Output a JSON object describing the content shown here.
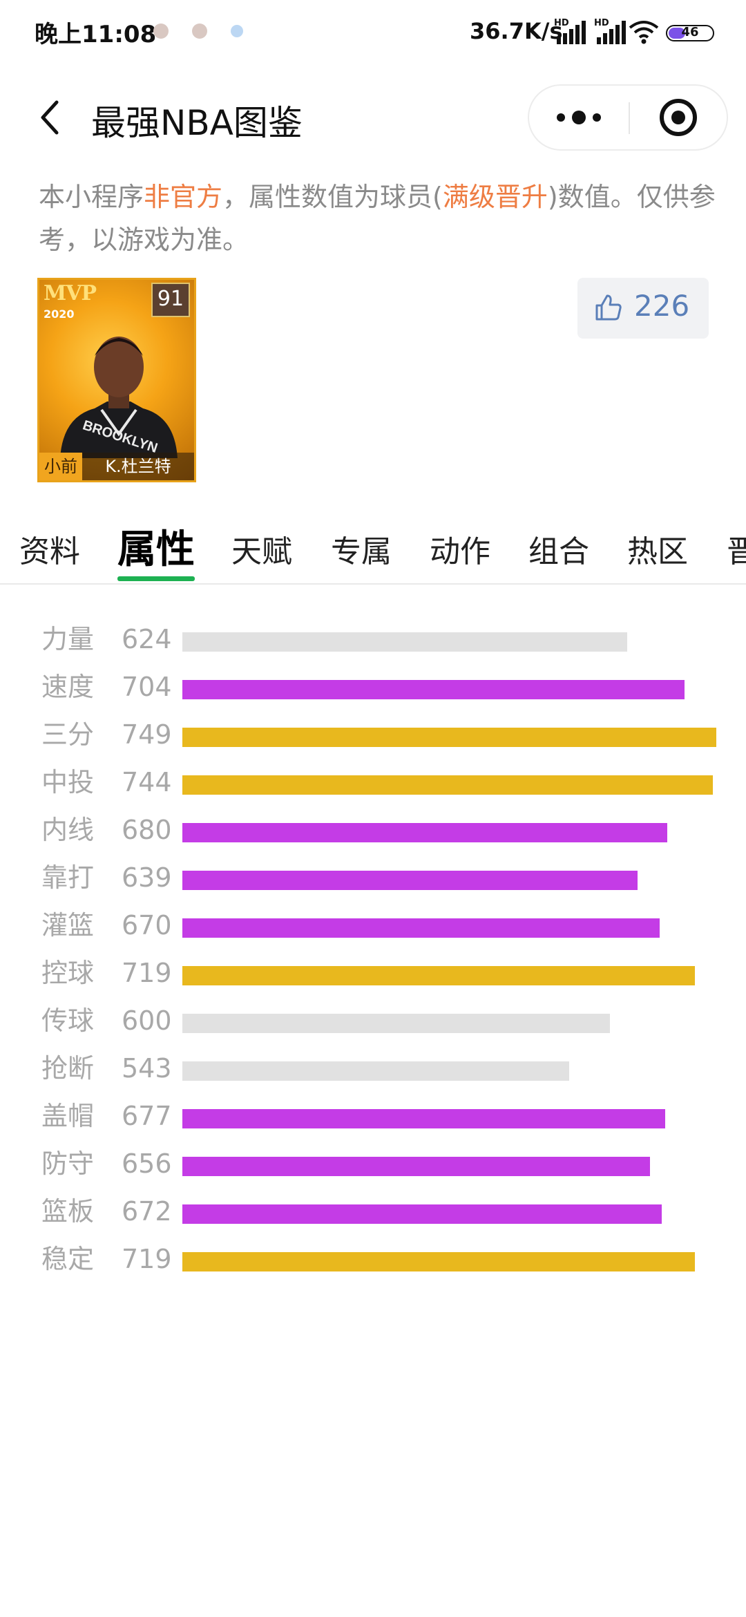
{
  "status_bar": {
    "time": "晚上11:08",
    "network_speed": "36.7K/s",
    "battery": "46"
  },
  "nav": {
    "title": "最强NBA图鉴"
  },
  "notice": {
    "part1": "本小程序",
    "highlight1": "非官方",
    "part2": "，属性数值为球员(",
    "highlight2": "满级晋升",
    "part3": ")数值。仅供参考，以游戏为准。"
  },
  "player_card": {
    "badge": "MVP",
    "year": "2020",
    "rating": "91",
    "position": "小前",
    "name": "K.杜兰特"
  },
  "likes": {
    "count": "226"
  },
  "tabs": [
    {
      "label": "资料",
      "active": false
    },
    {
      "label": "属性",
      "active": true
    },
    {
      "label": "天赋",
      "active": false
    },
    {
      "label": "专属",
      "active": false
    },
    {
      "label": "动作",
      "active": false
    },
    {
      "label": "组合",
      "active": false
    },
    {
      "label": "热区",
      "active": false
    },
    {
      "label": "晋",
      "active": false
    }
  ],
  "colors": {
    "gray": "#e1e1e1",
    "purple": "#c43ce6",
    "gold": "#e8b81e",
    "accent_green": "#1db152",
    "highlight_orange": "#ee7d43"
  },
  "attributes": [
    {
      "name": "力量",
      "value": 624,
      "tier": "gray"
    },
    {
      "name": "速度",
      "value": 704,
      "tier": "purple"
    },
    {
      "name": "三分",
      "value": 749,
      "tier": "gold"
    },
    {
      "name": "中投",
      "value": 744,
      "tier": "gold"
    },
    {
      "name": "内线",
      "value": 680,
      "tier": "purple"
    },
    {
      "name": "靠打",
      "value": 639,
      "tier": "purple"
    },
    {
      "name": "灌篮",
      "value": 670,
      "tier": "purple"
    },
    {
      "name": "控球",
      "value": 719,
      "tier": "gold"
    },
    {
      "name": "传球",
      "value": 600,
      "tier": "gray"
    },
    {
      "name": "抢断",
      "value": 543,
      "tier": "gray"
    },
    {
      "name": "盖帽",
      "value": 677,
      "tier": "purple"
    },
    {
      "name": "防守",
      "value": 656,
      "tier": "purple"
    },
    {
      "name": "篮板",
      "value": 672,
      "tier": "purple"
    },
    {
      "name": "稳定",
      "value": 719,
      "tier": "gold"
    }
  ]
}
